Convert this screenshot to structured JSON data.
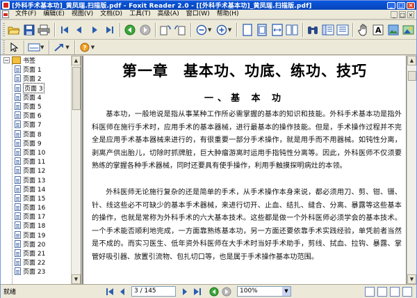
{
  "window": {
    "title": "[外科手术基本功]_黄凤瑞.扫描版.pdf - Foxit Reader 2.0 - [[外科手术基本功]_黄凤瑞.扫描版.pdf]",
    "controls": {
      "minimize": "_",
      "restore": "□",
      "close": "×"
    }
  },
  "menu": {
    "items": [
      "文件(F)",
      "编辑(E)",
      "视图(V)",
      "文档(D)",
      "工具(T)",
      "高级(A)",
      "窗口(W)",
      "帮助(H)"
    ],
    "mdi": {
      "minimize": "_",
      "restore": "□",
      "close": "×"
    }
  },
  "bookmarks": {
    "root_label": "书签",
    "expander": "−",
    "items": [
      "页面 1",
      "页面 2",
      "页面 3",
      "页面 4",
      "页面 5",
      "页面 6",
      "页面 7",
      "页面 8",
      "页面 9",
      "页面 10",
      "页面 11",
      "页面 12",
      "页面 13",
      "页面 14",
      "页面 15",
      "页面 16",
      "页面 17",
      "页面 18",
      "页面 19",
      "页面 20",
      "页面 21",
      "页面 22",
      "页面 23"
    ],
    "selected_index": 2
  },
  "scrollbar": {
    "up": "▲",
    "down": "▼"
  },
  "document": {
    "chapter_title": "第一章　基本功、功底、练功、技巧",
    "section_title": "一、基 本 功",
    "paragraph_1": "基本功，一般地说是指从事某种工作所必需掌握的基本的知识和技能。外科手术基本功是指外科医师在施行手术时，应用手术的基本器械，进行最基本的操作技能。但是，手术操作过程并不完全是应用手术基本器械来进行的，有很重要一部分手术操作，就是用手而不用器械。如钝性分离，剥离产供出胎儿，切除时抓牌脏，巨大肿瘤游离时运用手指钝性分离等。因此，外科医师不仅须要熟练的掌握各种手术器械，同时还要具有使手操作，利用手触摸探明病灶的本领。",
    "paragraph_2": "外科医师无论施行复杂的还是简单的手术，从手术操作本身来说，都必须用刀、剪、钳、镊、针、线这些必不可缺少的基本手术器械，来进行切开、止血、结扎、缝合、分离、暴露等这些基本的操作，也就是常称为外科手术的六大基本技术。这些都是做一个外科医师必须学会的基本技术。一个手术能否顺利地完成，一方面靠熟练基本功，另一方面还要依靠手术实践经验，单凭前者当然是不成的。而实习医生、低年资外科医师在大手术时当好手术助手，剪线、拭血、拉钩、暴露、掌管好吸引器、放置引流物、包扎切口等，也是属于手术操作基本功范围。"
  },
  "status": {
    "ready": "就绪",
    "page_display": "3 / 145",
    "zoom": "100%",
    "zoom_dropdown": "▼"
  },
  "colors": {
    "titlebar": "#0a58de",
    "selection": "#316ac5",
    "toolbar_bg": "#ece9d8"
  }
}
